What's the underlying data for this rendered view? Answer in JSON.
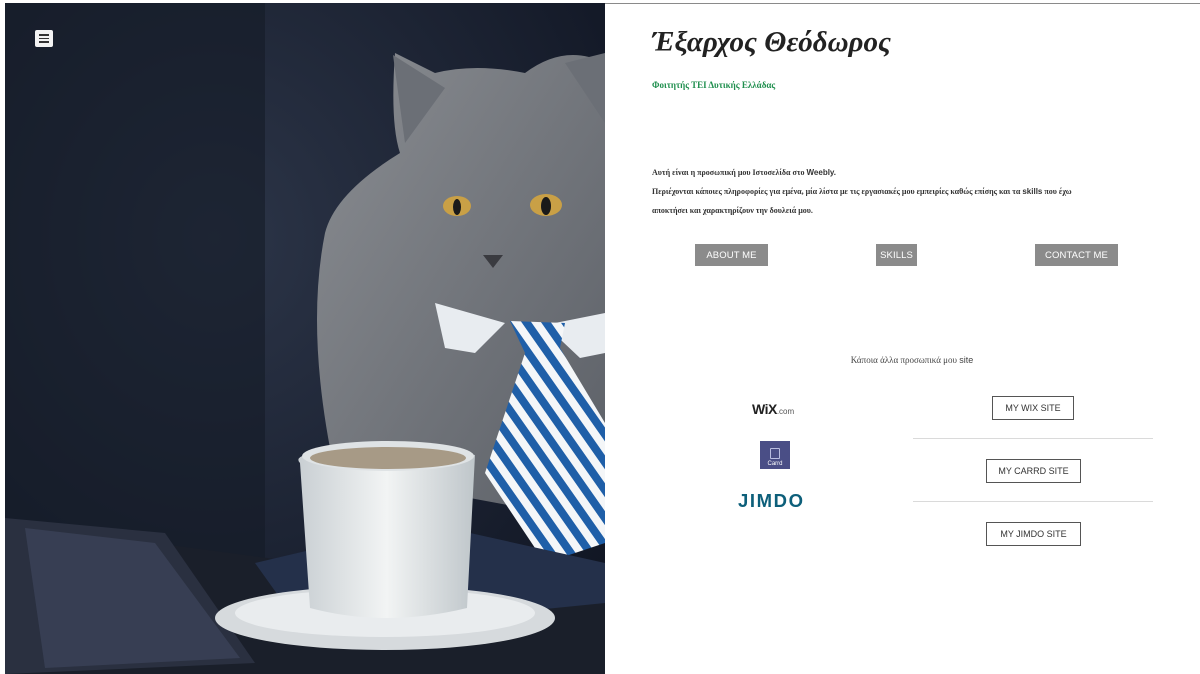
{
  "page": {
    "title": "Έξαρχος Θεόδωρος",
    "subtitle": "Φοιτητής ΤΕΙ Δυτικής Ελλάδας"
  },
  "intro": {
    "line1_prefix": "Αυτή είναι η προσωπική μου Ιστοσελίδα στο ",
    "line1_brand": "Weebly.",
    "line2_prefix": "Περιέχονται κάποιες πληροφορίες για εμένα, μία λίστα με τις εργασιακές μου εμπειρίες καθώς επίσης και τα ",
    "line2_skills": "skills",
    "line2_suffix": " που έχω",
    "line3": "αποκτήσει και χαρακτηρίζουν την δουλειά μου."
  },
  "nav_buttons": {
    "about": "ABOUT ME",
    "skills": "SKILLS",
    "contact": "CONTACT ME"
  },
  "other_sites": {
    "heading_prefix": "Κάποια άλλα προσωπικά μου ",
    "heading_site": "site",
    "wix_logo": "WiX",
    "wix_logo_suffix": ".com",
    "carrd_logo": "Carrd",
    "jimdo_logo": "JIMDO",
    "wix_button": "MY WIX SITE",
    "carrd_button": "MY CARRD SITE",
    "jimdo_button": "MY JIMDO SITE"
  },
  "colors": {
    "subtitle": "#1f8f4e",
    "button_gray": "#8b8b8b",
    "carrd_brand": "#4a4e86",
    "jimdo_brand": "#0d5f7a"
  },
  "icons": {
    "menu": "hamburger-menu-icon"
  }
}
